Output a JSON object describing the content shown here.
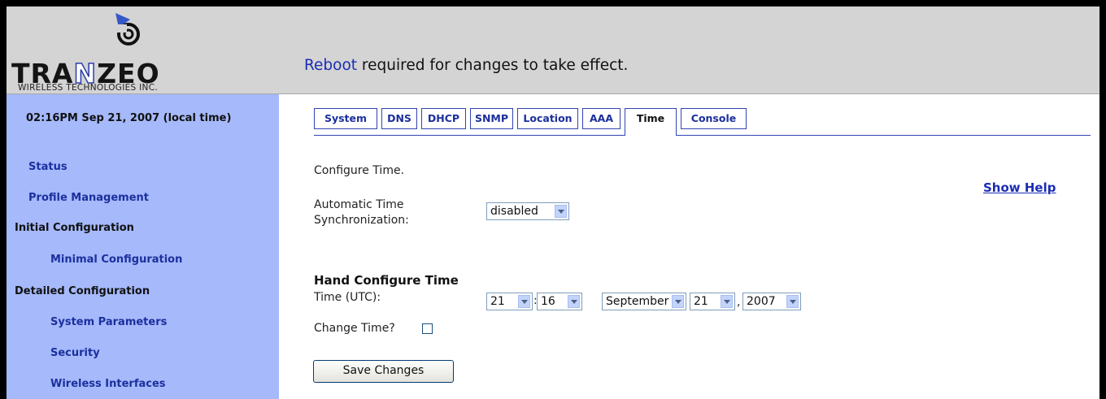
{
  "logo": {
    "wordmark_pre": "TRA",
    "wordmark_n": "N",
    "wordmark_post": "ZEO",
    "tagline": "WIRELESS TECHNOLOGIES INC."
  },
  "notice": {
    "link": "Reboot",
    "text": " required for changes to take effect."
  },
  "sidebar": {
    "clock": "02:16PM Sep 21, 2007 (local time)",
    "items": [
      {
        "label": "Status"
      },
      {
        "label": "Profile Management"
      },
      {
        "label": "Initial Configuration"
      },
      {
        "label": "Minimal Configuration"
      },
      {
        "label": "Detailed Configuration"
      },
      {
        "label": "System Parameters"
      },
      {
        "label": "Security"
      },
      {
        "label": "Wireless Interfaces"
      }
    ]
  },
  "tabs": [
    {
      "label": "System"
    },
    {
      "label": "DNS"
    },
    {
      "label": "DHCP"
    },
    {
      "label": "SNMP"
    },
    {
      "label": "Location"
    },
    {
      "label": "AAA"
    },
    {
      "label": "Time",
      "active": true
    },
    {
      "label": "Console"
    }
  ],
  "content": {
    "intro": "Configure Time.",
    "show_help": "Show Help",
    "auto_sync_label_1": "Automatic Time",
    "auto_sync_label_2": "Synchronization:",
    "auto_sync_value": "disabled",
    "hand_heading": "Hand Configure Time",
    "time_label": "Time (UTC):",
    "hour": "21",
    "colon": ":",
    "minute": "16",
    "month": "September",
    "day": "21",
    "comma": ",",
    "year": "2007",
    "change_time_label": "Change Time?",
    "change_time_checked": false,
    "save_button": "Save Changes"
  },
  "colors": {
    "sidebar_bg": "#a5b9fb",
    "header_bg": "#d4d4d4",
    "link": "#1b2db3",
    "tab_border": "#3143b5"
  }
}
